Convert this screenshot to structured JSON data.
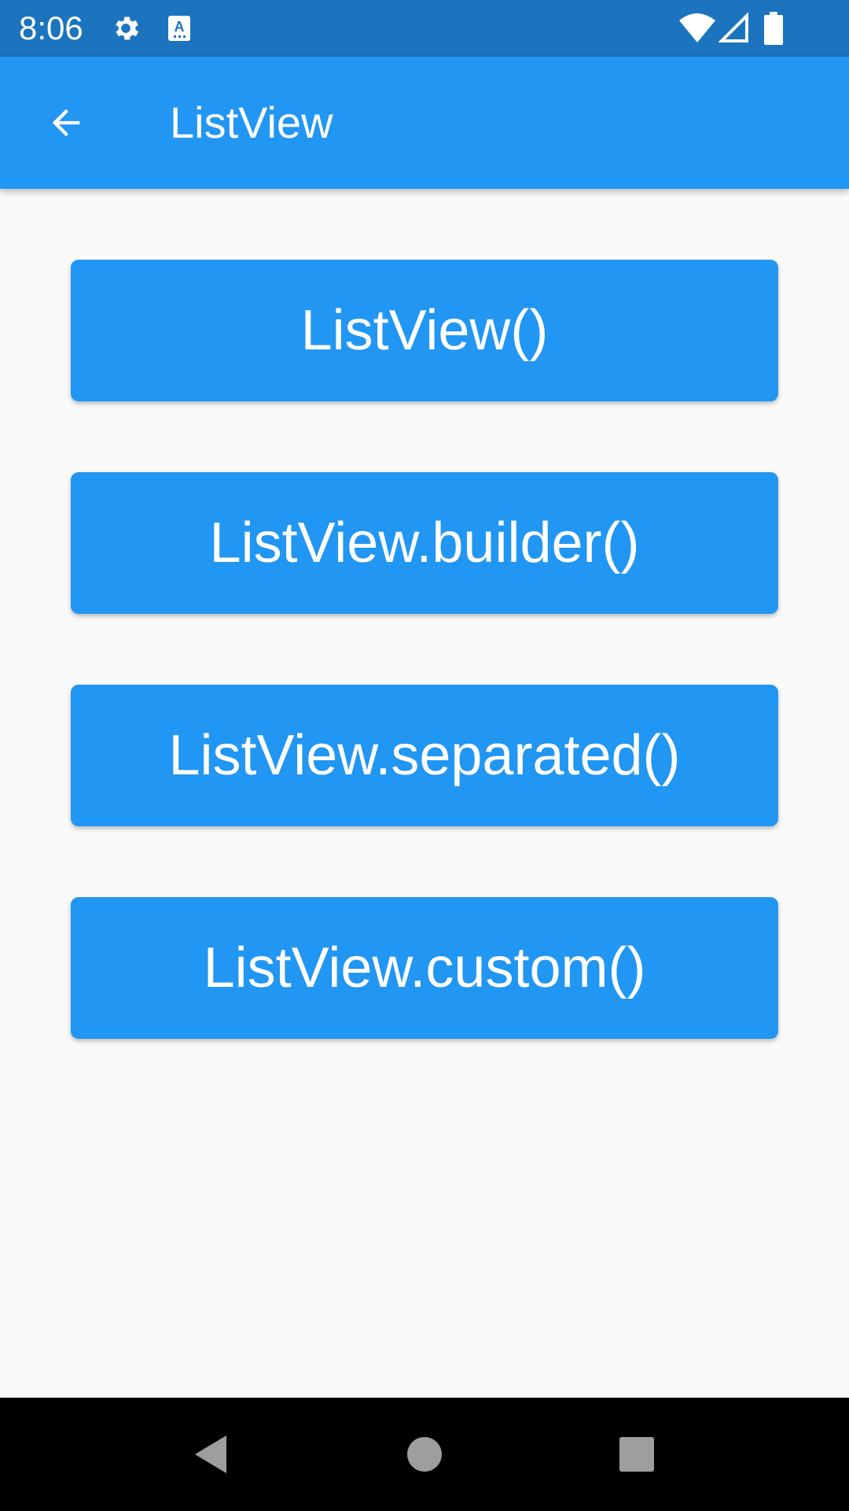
{
  "status_bar": {
    "time": "8:06",
    "icons": [
      "gear-icon",
      "keyboard-a-icon",
      "wifi-icon",
      "signal-icon",
      "battery-icon"
    ],
    "background": "#1b74bd"
  },
  "app_bar": {
    "title": "ListView",
    "back_icon": "arrow-back-icon",
    "background": "#2196f3"
  },
  "buttons": [
    {
      "label": "ListView()"
    },
    {
      "label": "ListView.builder()"
    },
    {
      "label": "ListView.separated()"
    },
    {
      "label": "ListView.custom()"
    }
  ],
  "nav_bar": {
    "icons": [
      "back-triangle-icon",
      "home-circle-icon",
      "recents-square-icon"
    ]
  },
  "colors": {
    "accent": "#2196f3",
    "background": "#fafafa",
    "nav_background": "#000000",
    "nav_icon": "#9e9e9e"
  }
}
